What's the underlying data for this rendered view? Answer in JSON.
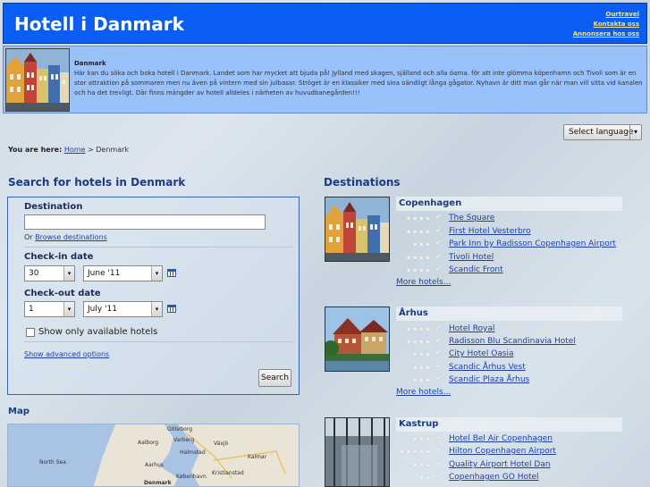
{
  "header": {
    "title": "Hotell i Danmark",
    "links": [
      "Ourtravel",
      "Kontakta oss",
      "Annonsera hos oss"
    ]
  },
  "intro": {
    "heading": "Danmark",
    "text": "Här kan du söka och boka hotell i Danmark. Landet som har mycket att bjuda på! Jylland med skagen, själland och alla öarna. för att inte glömma köpenhamn och Tivoli som är en stor attraktion på sommaren men nu även på vintern med sin julbasar. Ströget är en klassiker med sina oändligt långa gågator. Nyhavn är ditt man går när man vill sitta vid kanalen och ha det trevligt. Där finns mängder av hotell alldeles i närheten av huvudbanegården!!!"
  },
  "language": {
    "selected": "Select language",
    "arrow": "▾"
  },
  "breadcrumb": {
    "prefix": "You are here:",
    "home": "Home",
    "separator": ">",
    "current": "Denmark"
  },
  "search": {
    "title": "Search for hotels in Denmark",
    "destination_label": "Destination",
    "destination_value": "",
    "or_text": "Or",
    "browse_link": "Browse destinations",
    "checkin_label": "Check-in date",
    "checkin_day": "30",
    "checkin_month": "June '11",
    "checkout_label": "Check-out date",
    "checkout_day": "1",
    "checkout_month": "July '11",
    "available_label": "Show only available hotels",
    "advanced_link": "Show advanced options",
    "button": "Search",
    "arrow": "▾"
  },
  "map": {
    "title": "Map",
    "labels": [
      "North Sea",
      "Göteborg",
      "Aalborg",
      "Varberg",
      "Halmstad",
      "Växjö",
      "Kalmar",
      "Aarhus",
      "Kristianstad",
      "Denmark",
      "København"
    ]
  },
  "destinations": {
    "title": "Destinations",
    "more_label": "More hotels...",
    "cities": [
      {
        "name": "Copenhagen",
        "hotels": [
          {
            "name": "The Square",
            "stars": "★★★★"
          },
          {
            "name": "First Hotel Vesterbro",
            "stars": "★★★★"
          },
          {
            "name": "Park Inn by Radisson Copenhagen Airport",
            "stars": "★★★"
          },
          {
            "name": "Tivoli Hotel",
            "stars": "★★★★"
          },
          {
            "name": "Scandic Front",
            "stars": "★★★★"
          }
        ]
      },
      {
        "name": "Århus",
        "hotels": [
          {
            "name": "Hotel Royal",
            "stars": "★★★★"
          },
          {
            "name": "Radisson Blu Scandinavia Hotel",
            "stars": "★★★★"
          },
          {
            "name": "City Hotel Oasia",
            "stars": "★★★"
          },
          {
            "name": "Scandic Århus Vest",
            "stars": "★★★"
          },
          {
            "name": "Scandic Plaza Århus",
            "stars": "★★★"
          }
        ]
      },
      {
        "name": "Kastrup",
        "hotels": [
          {
            "name": "Hotel Bel Air Copenhagen",
            "stars": "★★★"
          },
          {
            "name": "Hilton Copenhagen Airport",
            "stars": "★★★★★"
          },
          {
            "name": "Quality Airport Hotel Dan",
            "stars": "★★★"
          },
          {
            "name": "Copenhagen GO Hotel",
            "stars": "★★"
          }
        ]
      }
    ]
  },
  "colors": {
    "header": "#0a5ef5",
    "intro": "#99c1fb",
    "link": "#1f3fa8",
    "title": "#1d3a86"
  }
}
